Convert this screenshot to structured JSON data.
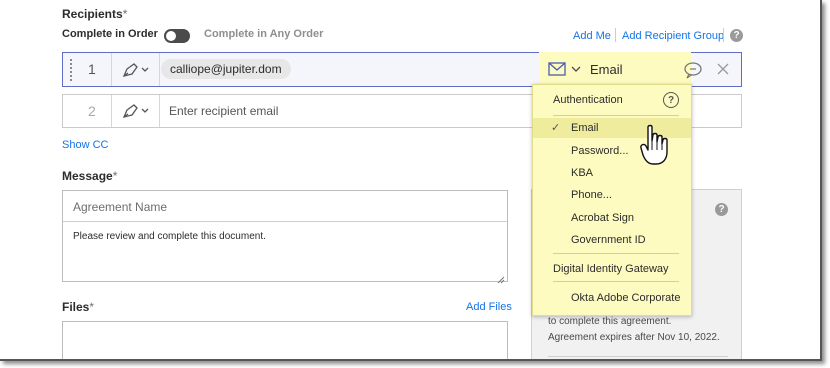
{
  "recipients": {
    "label": "Recipients",
    "required_mark": "*",
    "order_left": "Complete in Order",
    "order_right": "Complete in Any Order",
    "add_me": "Add Me",
    "add_group": "Add Recipient Group",
    "rows": [
      {
        "num": "1",
        "email": "calliope@jupiter.dom",
        "auth_label": "Email"
      },
      {
        "num": "2",
        "placeholder": "Enter recipient email"
      }
    ],
    "show_cc": "Show CC"
  },
  "message": {
    "label": "Message",
    "required_mark": "*",
    "agreement_name_placeholder": "Agreement Name",
    "body": "Please review and complete this document."
  },
  "files": {
    "label": "Files",
    "required_mark": "*",
    "add_files": "Add Files"
  },
  "side_panel": {
    "line1": "to complete this agreement.",
    "line2": "Agreement expires after Nov 10, 2022."
  },
  "auth_menu": {
    "header": "Authentication",
    "items": [
      "Email",
      "Password...",
      "KBA",
      "Phone...",
      "Acrobat Sign",
      "Government ID"
    ],
    "selected": "Email",
    "section2": "Digital Identity Gateway",
    "section3": "Okta Adobe Corporate"
  },
  "colors": {
    "link": "#1473e6",
    "menu_bg": "#fdfbc0",
    "active_row_border": "#5f6ec4"
  }
}
